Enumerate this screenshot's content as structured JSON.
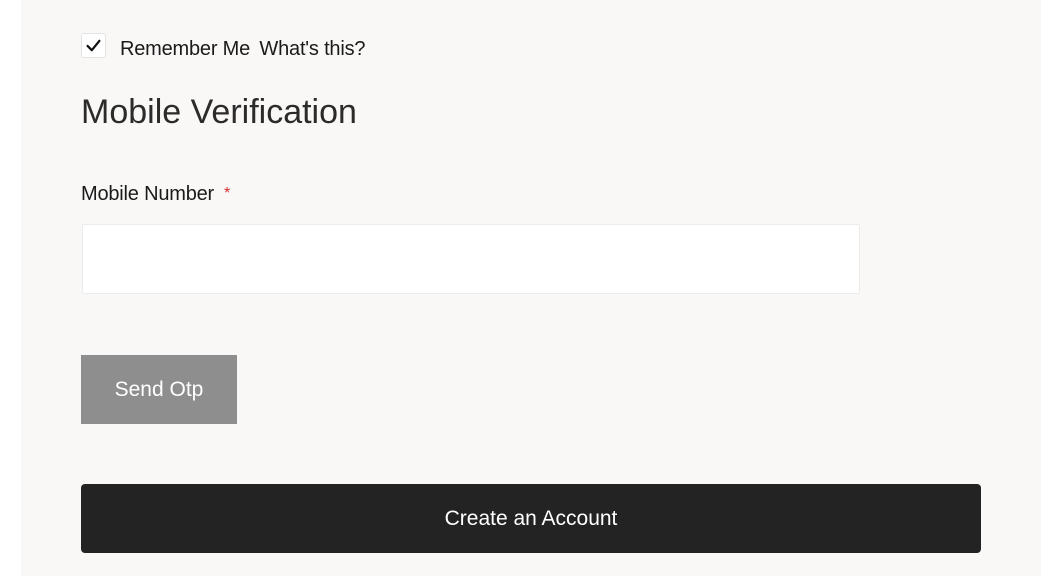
{
  "remember": {
    "checked": true,
    "label": "Remember Me",
    "help_link": "What's this?"
  },
  "verification": {
    "title": "Mobile Verification",
    "mobile_label": "Mobile Number",
    "required_marker": "*",
    "mobile_value": "",
    "send_otp_label": "Send Otp"
  },
  "actions": {
    "create_account_label": "Create an Account"
  },
  "colors": {
    "panel_bg": "#f9f8f7",
    "send_otp_bg": "#8e8e8e",
    "create_account_bg": "#232323",
    "required": "#d32f2f"
  },
  "icons": {
    "checkbox": "checkmark-icon"
  }
}
